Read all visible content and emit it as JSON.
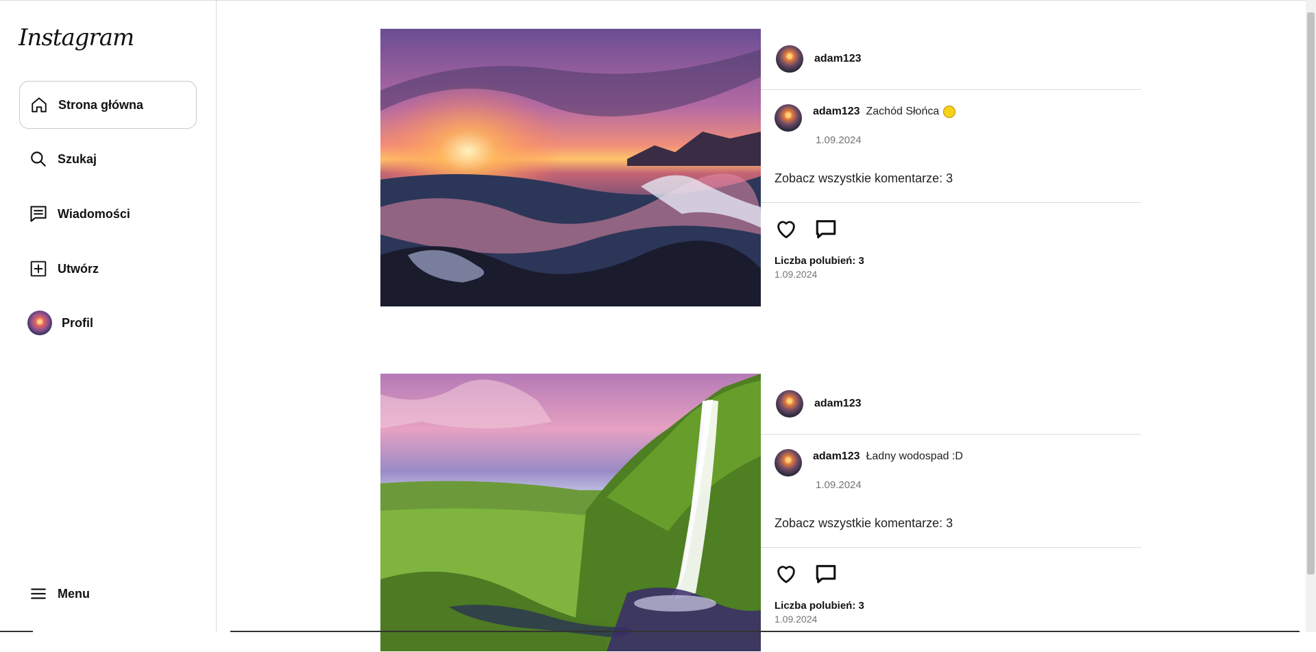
{
  "app": {
    "logo_text": "Instagram"
  },
  "sidebar": {
    "items": [
      {
        "label": "Strona główna",
        "icon": "home-icon",
        "active": true
      },
      {
        "label": "Szukaj",
        "icon": "search-icon"
      },
      {
        "label": "Wiadomości",
        "icon": "messages-icon"
      },
      {
        "label": "Utwórz",
        "icon": "create-icon"
      },
      {
        "label": "Profil",
        "icon": "avatar"
      }
    ],
    "menu_label": "Menu"
  },
  "posts": [
    {
      "username": "adam123",
      "caption_user": "adam123",
      "caption": "Zachód Słońca",
      "caption_emoji": "sun-emoji",
      "caption_date": "1.09.2024",
      "view_comments": "Zobacz wszystkie komentarze: 3",
      "likes": "Liczba polubień: 3",
      "date": "1.09.2024",
      "image": "sunset-ocean-waves"
    },
    {
      "username": "adam123",
      "caption_user": "adam123",
      "caption": "Ładny wodospad :D",
      "caption_date": "1.09.2024",
      "view_comments": "Zobacz wszystkie komentarze: 3",
      "likes": "Liczba polubień: 3",
      "date": "1.09.2024",
      "image": "waterfall-green-valley"
    }
  ],
  "colors": {
    "border": "#dbdbdb",
    "muted_text": "#737373",
    "text": "#111111"
  }
}
